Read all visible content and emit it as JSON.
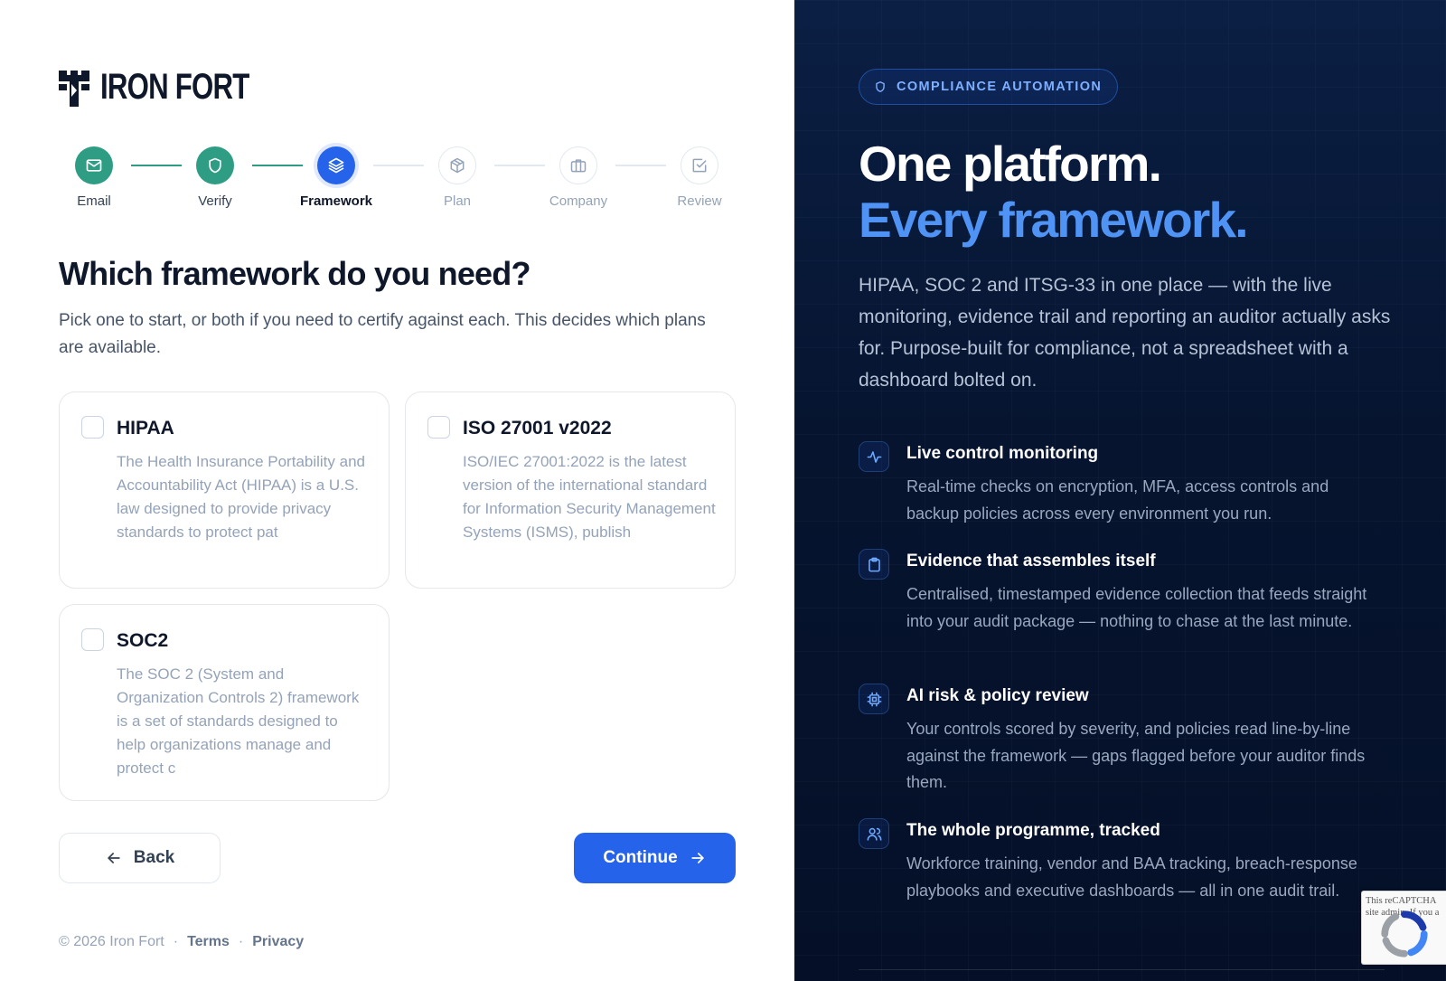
{
  "brand": {
    "name": "IRON FORT"
  },
  "stepper": [
    {
      "label": "Email",
      "status": "done",
      "icon": "mail-icon"
    },
    {
      "label": "Verify",
      "status": "done",
      "icon": "shield-icon"
    },
    {
      "label": "Framework",
      "status": "active",
      "icon": "layers-icon"
    },
    {
      "label": "Plan",
      "status": "todo",
      "icon": "box-icon"
    },
    {
      "label": "Company",
      "status": "todo",
      "icon": "briefcase-icon"
    },
    {
      "label": "Review",
      "status": "todo",
      "icon": "check-square-icon"
    }
  ],
  "main": {
    "title": "Which framework do you need?",
    "subtitle": "Pick one to start, or both if you need to certify against each. This decides which plans are available.",
    "frameworks": [
      {
        "name": "HIPAA",
        "checked": false,
        "description": "The Health Insurance Portability and Accountability Act (HIPAA) is a U.S. law designed to provide privacy standards to protect pat"
      },
      {
        "name": "ISO 27001 v2022",
        "checked": false,
        "description": "ISO/IEC 27001:2022 is the latest version of the international standard for Information Security Management Systems (ISMS), publish"
      },
      {
        "name": "SOC2",
        "checked": false,
        "description": "The SOC 2 (System and Organization Controls 2) framework is a set of standards designed to help organizations manage and protect c"
      }
    ],
    "back_label": "Back",
    "continue_label": "Continue"
  },
  "footer": {
    "copyright": "© 2026 Iron Fort",
    "separator": "·",
    "terms": "Terms",
    "privacy": "Privacy"
  },
  "promo": {
    "badge": "COMPLIANCE AUTOMATION",
    "headline_line1": "One platform.",
    "headline_line2": "Every framework.",
    "intro": "HIPAA, SOC 2 and ITSG-33 in one place — with the live monitoring, evidence trail and reporting an auditor actually asks for. Purpose-built for compliance, not a spreadsheet with a dashboard bolted on.",
    "features": [
      {
        "icon": "activity-icon",
        "title": "Live control monitoring",
        "description": "Real-time checks on encryption, MFA, access controls and backup policies across every environment you run."
      },
      {
        "icon": "clipboard-icon",
        "title": "Evidence that assembles itself",
        "description": "Centralised, timestamped evidence collection that feeds straight into your audit package — nothing to chase at the last minute."
      },
      {
        "icon": "cpu-icon",
        "title": "AI risk & policy review",
        "description": "Your controls scored by severity, and policies read line-by-line against the framework — gaps flagged before your auditor finds them."
      },
      {
        "icon": "users-icon",
        "title": "The whole programme, tracked",
        "description": "Workforce training, vendor and BAA tracking, breach-response playbooks and executive dashboards — all in one audit trail."
      }
    ]
  },
  "recaptcha": {
    "text": "This reCAPTCHA site admin. If you a"
  },
  "colors": {
    "accent": "#2563eb",
    "done": "#2f9d84",
    "panel_bg": "#06142f",
    "headline_accent": "#4f93f5"
  }
}
